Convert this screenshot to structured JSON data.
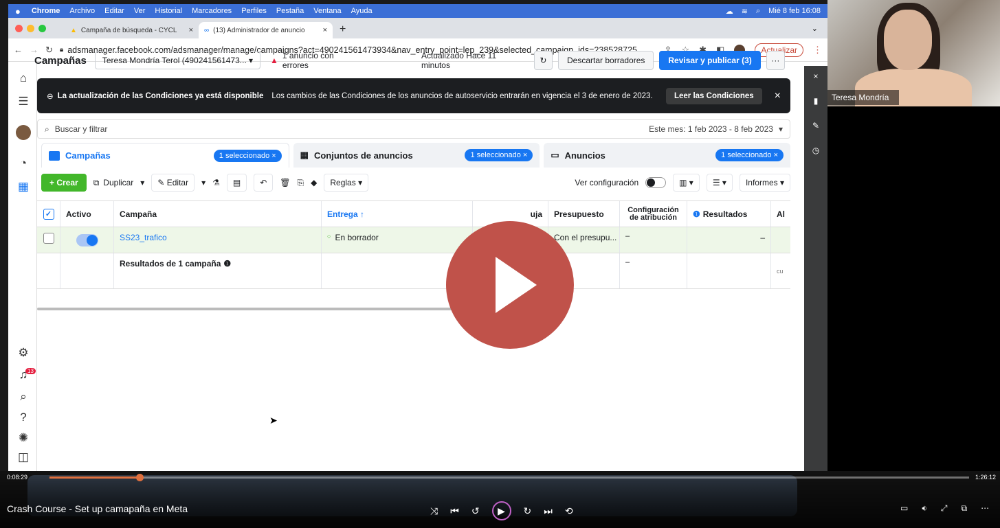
{
  "menubar": {
    "apple": "",
    "app": "Chrome",
    "items": [
      "Archivo",
      "Editar",
      "Ver",
      "Historial",
      "Marcadores",
      "Perfiles",
      "Pestaña",
      "Ventana",
      "Ayuda"
    ],
    "datetime": "Mié 8 feb 16:08"
  },
  "browser": {
    "tabs": [
      {
        "label": "Campaña de búsqueda - CYCL"
      },
      {
        "label": "(13) Administrador de anuncio"
      }
    ],
    "url": "adsmanager.facebook.com/adsmanager/manage/campaigns?act=490241561473934&nav_entry_point=lep_239&selected_campaign_ids=238528725...",
    "update_label": "Actualizar"
  },
  "topbar": {
    "title": "Campañas",
    "account": "Teresa Mondría Terol (490241561473...",
    "warning": "1 anuncio con errores",
    "updated": "Actualizado Hace 11 minutos",
    "discard": "Descartar borradores",
    "publish": "Revisar y publicar (3)",
    "more": "···"
  },
  "banner": {
    "title": "La actualización de las Condiciones ya está disponible",
    "body": "Los cambios de las Condiciones de los anuncios de autoservicio entrarán en vigencia el 3 de enero de 2023.",
    "button": "Leer las Condiciones"
  },
  "search": {
    "placeholder": "Buscar y filtrar",
    "date_range": "Este mes: 1 feb 2023 - 8 feb 2023"
  },
  "level_tabs": [
    {
      "label": "Campañas",
      "selected": "1 seleccionado"
    },
    {
      "label": "Conjuntos de anuncios",
      "selected": "1 seleccionado"
    },
    {
      "label": "Anuncios",
      "selected": "1 seleccionado"
    }
  ],
  "toolbar": {
    "create": "+ Crear",
    "duplicate": "Duplicar",
    "edit": "Editar",
    "rules": "Reglas",
    "view_config": "Ver configuración",
    "reports": "Informes"
  },
  "table": {
    "headers": {
      "active": "Activo",
      "campaign": "Campaña",
      "delivery": "Entrega ↑",
      "bid": "uja",
      "budget": "Presupuesto",
      "attribution": "Configuración de atribución",
      "results": "Resultados",
      "more": "Al"
    },
    "row": {
      "name": "SS23_trafico",
      "delivery": "En borrador",
      "budget": "Con el presupu...",
      "attribution": "–",
      "results": "–"
    },
    "total": {
      "label": "Resultados de 1 campaña",
      "attribution": "–",
      "tail": "cu"
    }
  },
  "rail": {
    "notifications": "13"
  },
  "webcam": {
    "name": "Teresa Mondría"
  },
  "video": {
    "title": "Crash Course - Set up camapaña en Meta",
    "elapsed": "0:08:29",
    "total": "1:26:12",
    "progress_fraction": 0.098
  }
}
